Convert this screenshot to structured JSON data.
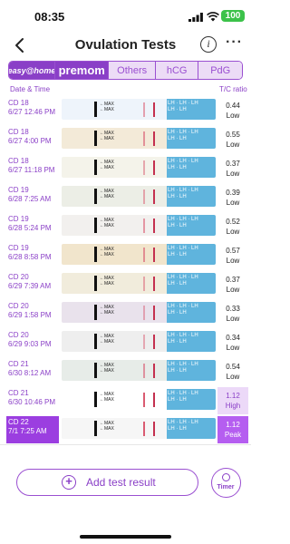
{
  "status_bar": {
    "time": "08:35",
    "battery": "100"
  },
  "nav": {
    "title": "Ovulation Tests"
  },
  "tabs": [
    {
      "label": "easy@home"
    },
    {
      "label": "premom"
    },
    {
      "label": "Others"
    },
    {
      "label": "hCG"
    },
    {
      "label": "PdG"
    }
  ],
  "columns": {
    "date": "Date & Time",
    "ratio": "T/C ratio"
  },
  "rows": [
    {
      "day": "CD 18",
      "datetime": "6/27 12:46 PM",
      "ratio": "0.44",
      "level": "Low",
      "strip_color": "#eef4fb"
    },
    {
      "day": "CD 18",
      "datetime": "6/27 4:00 PM",
      "ratio": "0.55",
      "level": "Low",
      "strip_color": "#f3ead8"
    },
    {
      "day": "CD 18",
      "datetime": "6/27 11:18 PM",
      "ratio": "0.37",
      "level": "Low",
      "strip_color": "#f4f3ea"
    },
    {
      "day": "CD 19",
      "datetime": "6/28 7:25 AM",
      "ratio": "0.39",
      "level": "Low",
      "strip_color": "#eceee6"
    },
    {
      "day": "CD 19",
      "datetime": "6/28 5:24 PM",
      "ratio": "0.52",
      "level": "Low",
      "strip_color": "#f2f0ee"
    },
    {
      "day": "CD 19",
      "datetime": "6/28 8:58 PM",
      "ratio": "0.57",
      "level": "Low",
      "strip_color": "#f1e5cc"
    },
    {
      "day": "CD 20",
      "datetime": "6/29 7:39 AM",
      "ratio": "0.37",
      "level": "Low",
      "strip_color": "#f1ecdc"
    },
    {
      "day": "CD 20",
      "datetime": "6/29 1:58 PM",
      "ratio": "0.33",
      "level": "Low",
      "strip_color": "#e9e2ec"
    },
    {
      "day": "CD 20",
      "datetime": "6/29 9:03 PM",
      "ratio": "0.34",
      "level": "Low",
      "strip_color": "#eeeeee"
    },
    {
      "day": "CD 21",
      "datetime": "6/30 8:12 AM",
      "ratio": "0.54",
      "level": "Low",
      "strip_color": "#e7ece8"
    },
    {
      "day": "CD 21",
      "datetime": "6/30 10:46 PM",
      "ratio": "1.12",
      "level": "High",
      "strip_color": "#ffffff"
    },
    {
      "day": "CD 22",
      "datetime": "7/1 7:25 AM",
      "ratio": "1.12",
      "level": "Peak",
      "strip_color": "#f6f6f6"
    }
  ],
  "strip_text": {
    "max": "MAX",
    "brand": "LH"
  },
  "actions": {
    "add_label": "Add test result",
    "timer_label": "Timer"
  },
  "colors": {
    "accent": "#8a3fc7",
    "peak": "#9b3ee0",
    "strip_blue": "#5fb4dd"
  },
  "icons": [
    "back-icon",
    "info-icon",
    "more-icon",
    "add-icon",
    "timer-icon"
  ]
}
